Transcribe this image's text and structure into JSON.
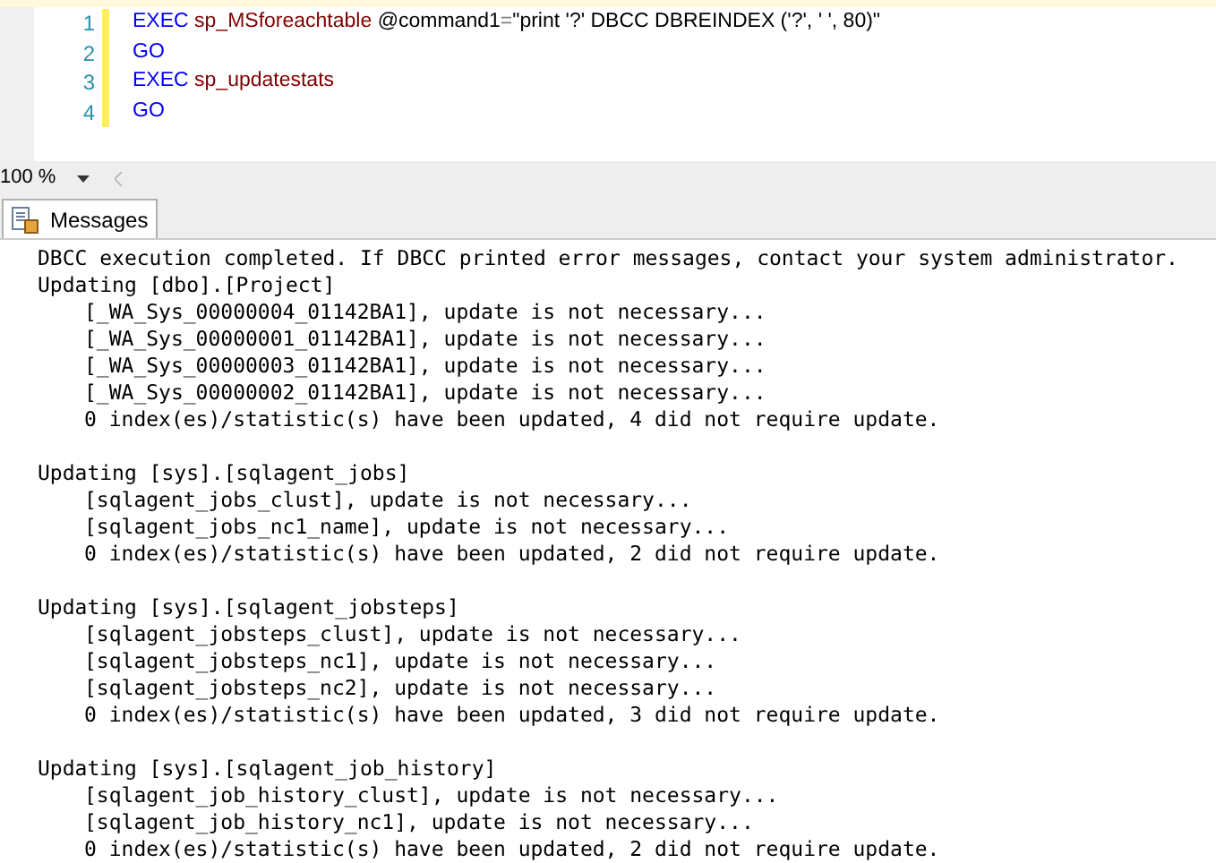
{
  "editor": {
    "lines": [
      {
        "number": "1",
        "tokens": [
          {
            "kind": "keyword",
            "text": "EXEC"
          },
          {
            "kind": "proc",
            "text": "sp_MSforeachtable"
          },
          {
            "kind": "plain",
            "text": "@command1"
          },
          {
            "kind": "operator",
            "text": "="
          },
          {
            "kind": "plain",
            "text": "\"print '?' DBCC DBREINDEX ('?', ' ', 80)\""
          }
        ]
      },
      {
        "number": "2",
        "tokens": [
          {
            "kind": "keyword",
            "text": "GO"
          }
        ]
      },
      {
        "number": "3",
        "tokens": [
          {
            "kind": "keyword",
            "text": "EXEC"
          },
          {
            "kind": "proc",
            "text": "sp_updatestats"
          }
        ]
      },
      {
        "number": "4",
        "tokens": [
          {
            "kind": "keyword",
            "text": "GO"
          }
        ]
      }
    ]
  },
  "zoom": {
    "value": "100 %"
  },
  "tabs": [
    {
      "label": "Messages",
      "selected": true
    }
  ],
  "messages": {
    "status_line": "DBCC execution completed. If DBCC printed error messages, contact your system administrator.",
    "update_groups": [
      {
        "heading": "Updating [dbo].[Project]",
        "lines": [
          "[_WA_Sys_00000004_01142BA1], update is not necessary...",
          "[_WA_Sys_00000001_01142BA1], update is not necessary...",
          "[_WA_Sys_00000003_01142BA1], update is not necessary...",
          "[_WA_Sys_00000002_01142BA1], update is not necessary...",
          "0 index(es)/statistic(s) have been updated, 4 did not require update."
        ]
      },
      {
        "heading": "Updating [sys].[sqlagent_jobs]",
        "lines": [
          "[sqlagent_jobs_clust], update is not necessary...",
          "[sqlagent_jobs_nc1_name], update is not necessary...",
          "0 index(es)/statistic(s) have been updated, 2 did not require update."
        ]
      },
      {
        "heading": "Updating [sys].[sqlagent_jobsteps]",
        "lines": [
          "[sqlagent_jobsteps_clust], update is not necessary...",
          "[sqlagent_jobsteps_nc1], update is not necessary...",
          "[sqlagent_jobsteps_nc2], update is not necessary...",
          "0 index(es)/statistic(s) have been updated, 3 did not require update."
        ]
      },
      {
        "heading": "Updating [sys].[sqlagent_job_history]",
        "lines": [
          "[sqlagent_job_history_clust], update is not necessary...",
          "[sqlagent_job_history_nc1], update is not necessary...",
          "0 index(es)/statistic(s) have been updated, 2 did not require update."
        ]
      }
    ]
  }
}
